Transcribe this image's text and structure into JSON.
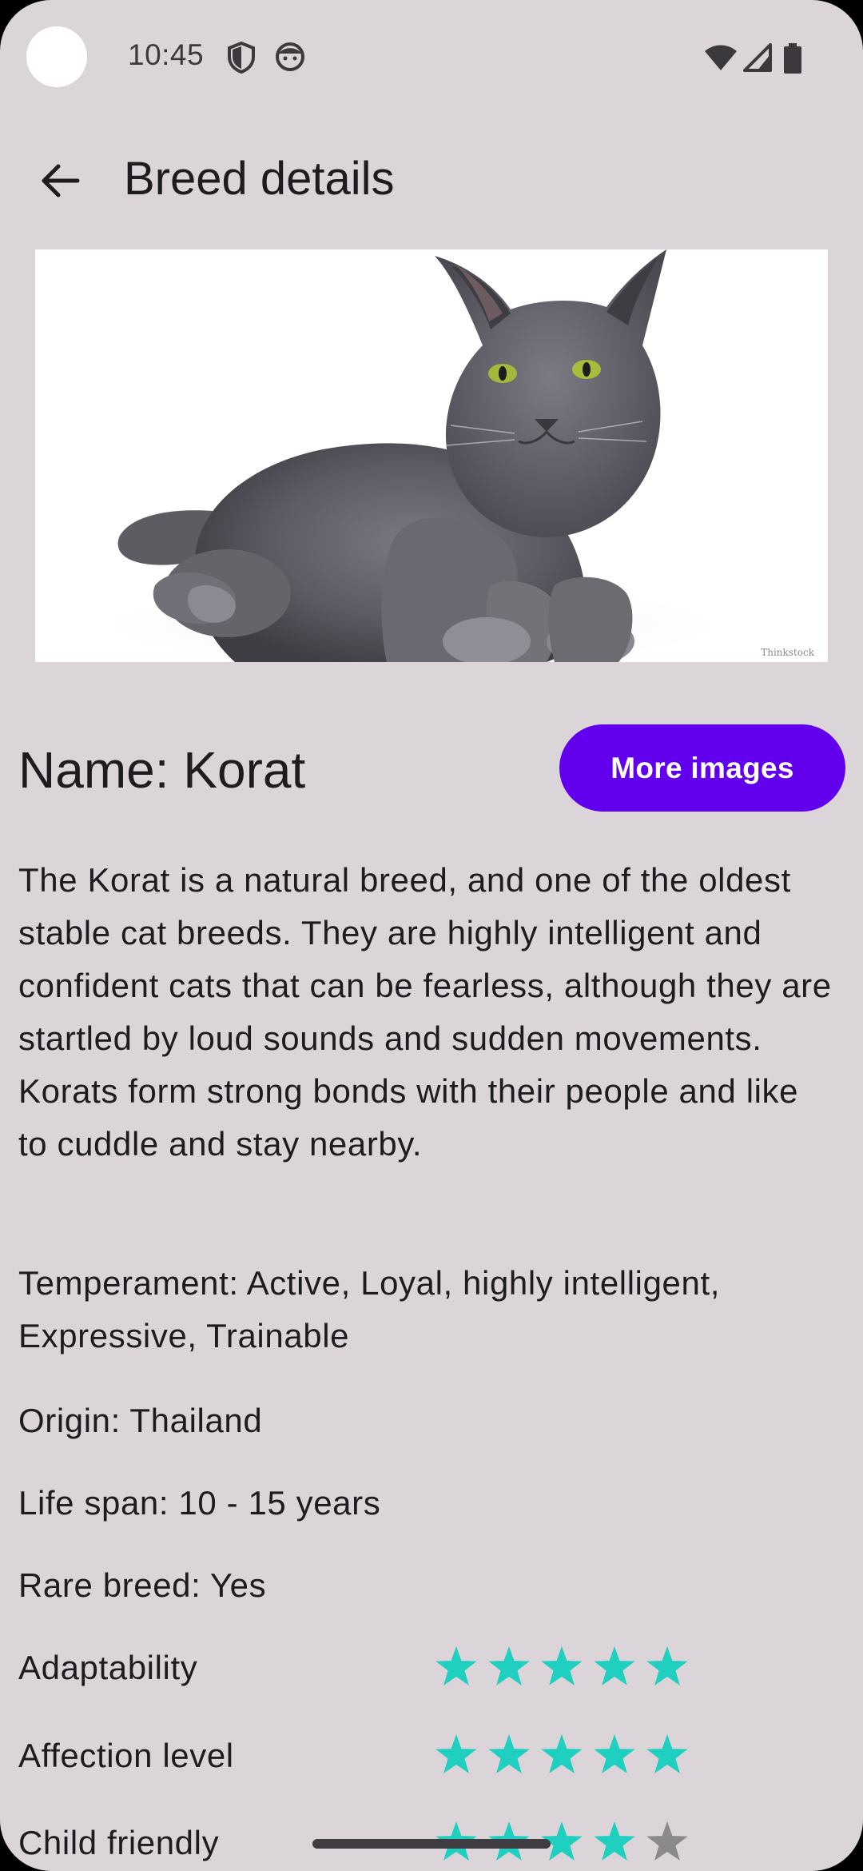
{
  "status_bar": {
    "time": "10:45",
    "icons": [
      "shield-icon",
      "face-icon",
      "wifi-icon",
      "signal-icon",
      "battery-icon"
    ]
  },
  "app_bar": {
    "back_icon": "arrow-back-icon",
    "title": "Breed details"
  },
  "hero": {
    "credit": "Thinkstock"
  },
  "breed": {
    "name_line": "Name: Korat",
    "more_images_label": "More images",
    "description": "The Korat is a natural breed, and one of the oldest stable cat breeds. They are highly intelligent and confident cats that can be fearless, although they are startled by loud sounds and sudden movements. Korats form strong bonds with their people and like to cuddle and stay nearby.",
    "temperament": "Temperament: Active, Loyal, highly intelligent, Expressive, Trainable",
    "origin": "Origin: Thailand",
    "life_span": "Life span: 10 - 15 years",
    "rare": "Rare breed: Yes"
  },
  "ratings": [
    {
      "label": "Adaptability",
      "value": 5,
      "max": 5
    },
    {
      "label": "Affection level",
      "value": 5,
      "max": 5
    },
    {
      "label": "Child friendly",
      "value": 4,
      "max": 5
    }
  ],
  "colors": {
    "background": "#dbd5da",
    "accent": "#6200ee",
    "star_filled": "#1fcfbf",
    "star_empty": "#8a8a8a"
  }
}
